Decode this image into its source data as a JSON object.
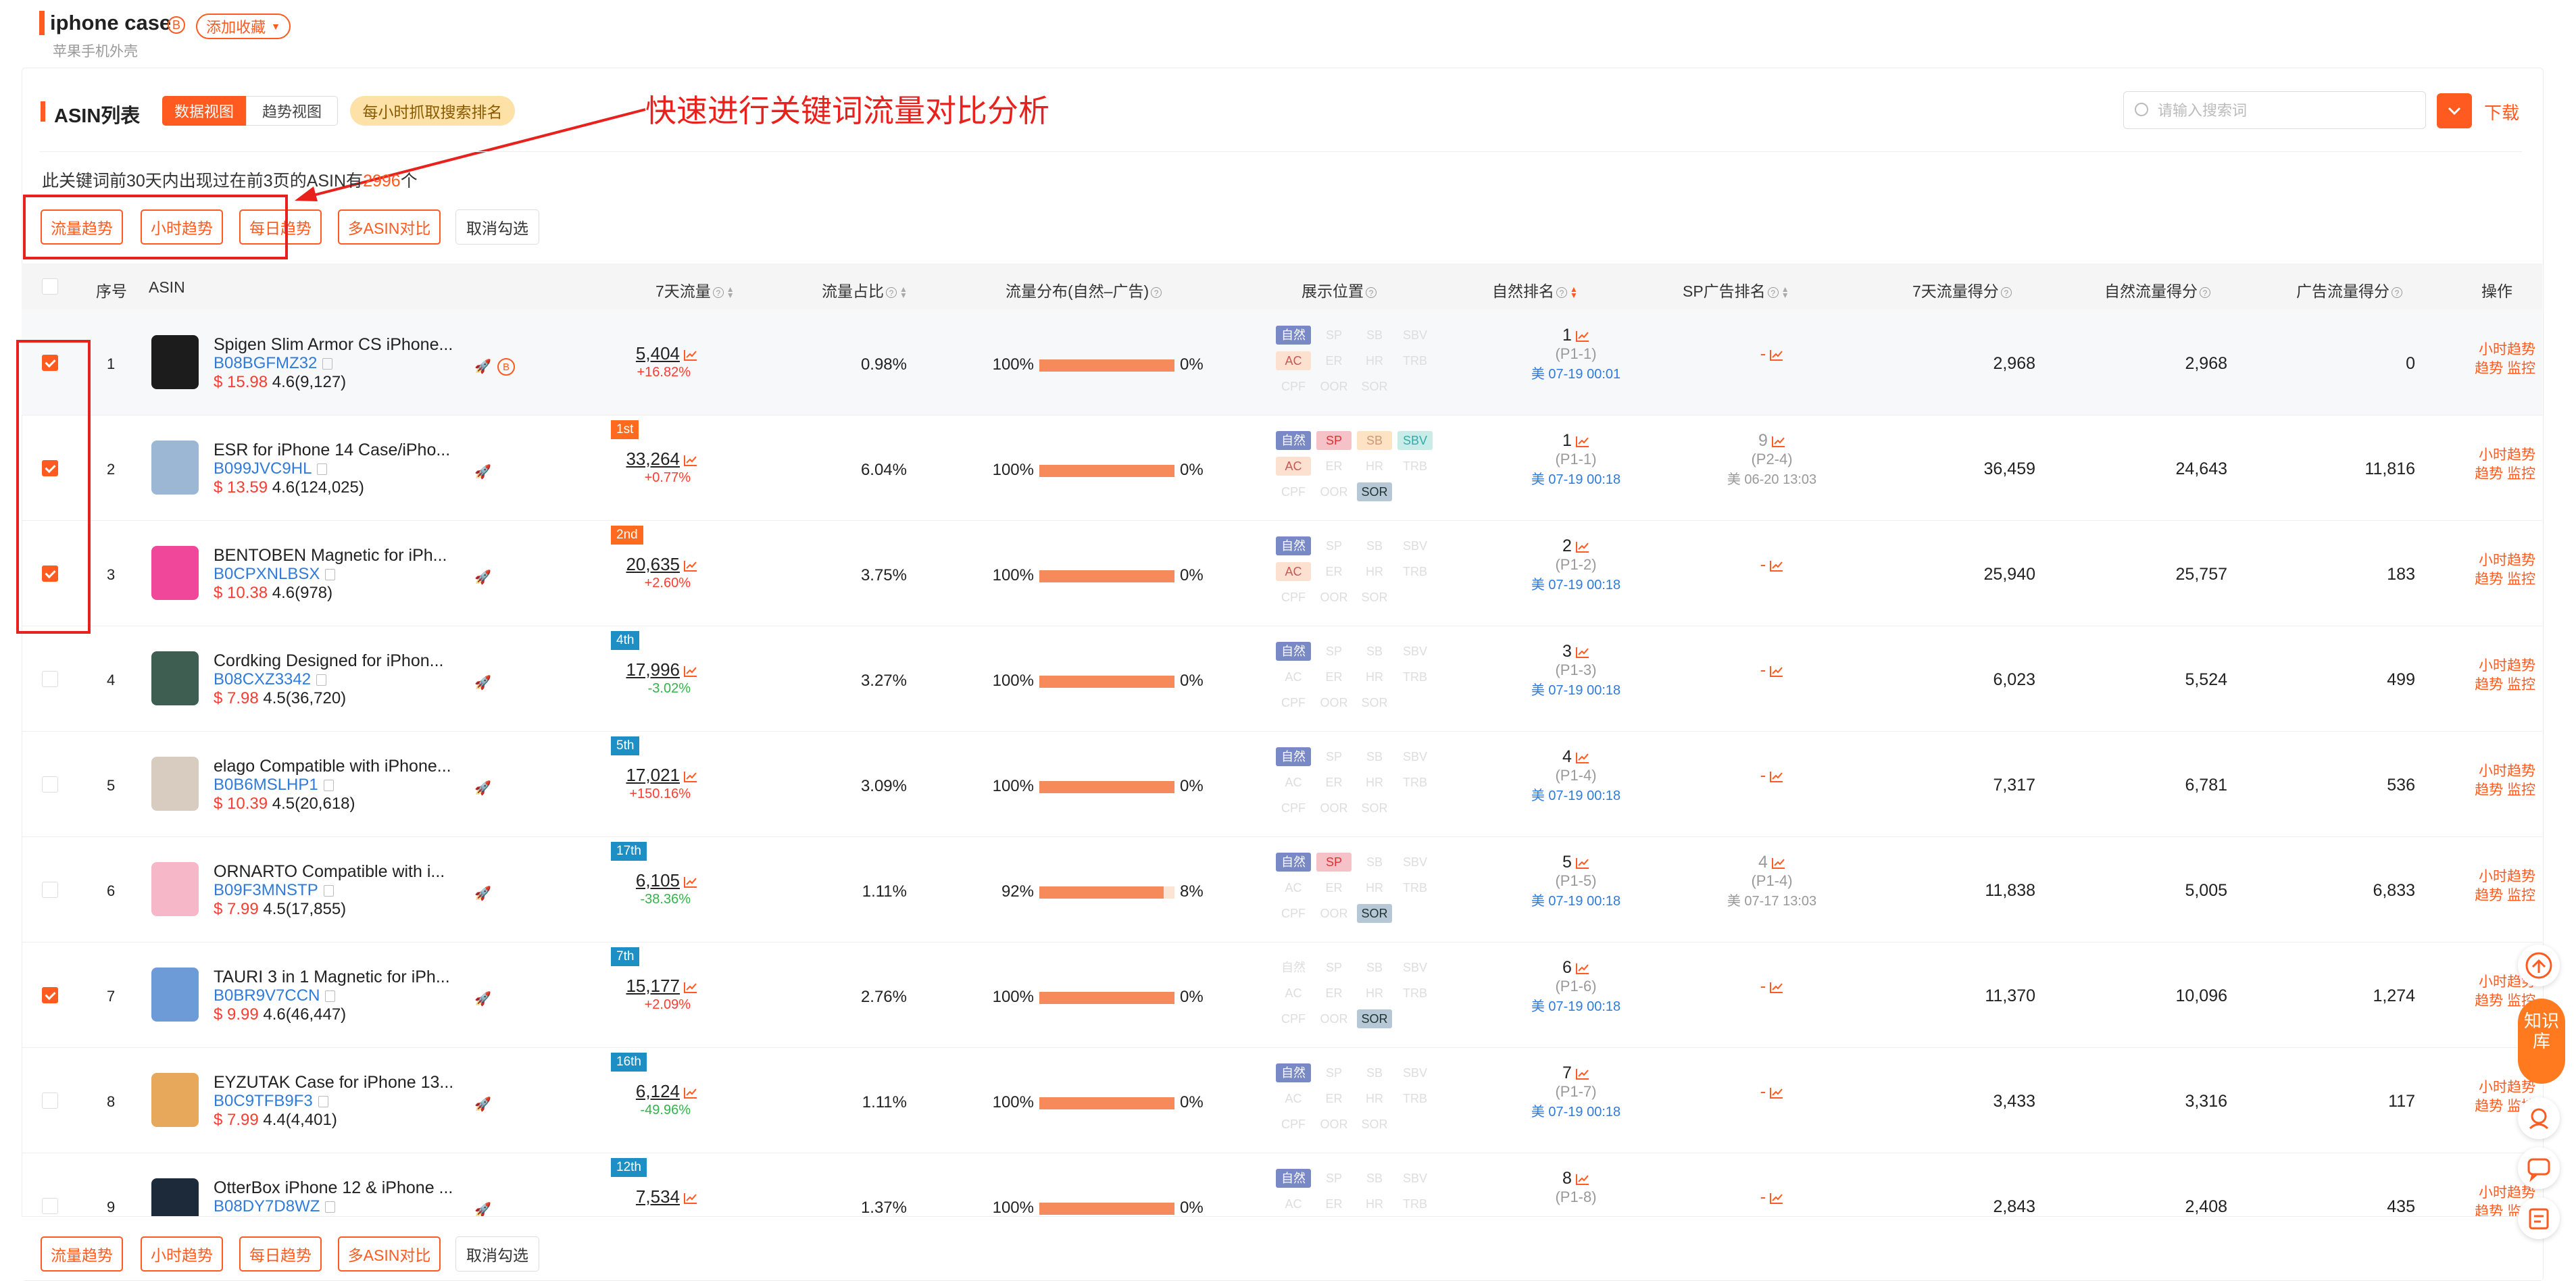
{
  "header": {
    "keyword": "iphone case",
    "badge": "B",
    "add_favorite": "添加收藏",
    "translation": "苹果手机外壳"
  },
  "section": {
    "title": "ASIN列表",
    "tab_data": "数据视图",
    "tab_trend": "趋势视图",
    "hourly_pill": "每小时抓取搜索排名",
    "annotation": "快速进行关键词流量对比分析",
    "search_placeholder": "请输入搜索词",
    "download": "下载",
    "summary_prefix": "此关键词前30天内出现过在前3页的ASIN有",
    "summary_count": "2996",
    "summary_suffix": "个"
  },
  "actions": {
    "flow_trend": "流量趋势",
    "hourly_trend": "小时趋势",
    "daily_trend": "每日趋势",
    "multi_asin": "多ASIN对比",
    "cancel": "取消勾选"
  },
  "columns": {
    "index": "序号",
    "asin": "ASIN",
    "flow7": "7天流量",
    "share": "流量占比",
    "dist": "流量分布(自然–广告)",
    "pos": "展示位置",
    "natural_rank": "自然排名",
    "sp_rank": "SP广告排名",
    "score7": "7天流量得分",
    "natural_score": "自然流量得分",
    "ad_score": "广告流量得分",
    "ops": "操作"
  },
  "tags": {
    "nat": "自然",
    "sp": "SP",
    "sb": "SB",
    "sbv": "SBV",
    "ac": "AC",
    "er": "ER",
    "hr": "HR",
    "trb": "TRB",
    "cpf": "CPF",
    "oor": "OOR",
    "sor": "SOR"
  },
  "row_ops": {
    "hourly": "小时趋势",
    "trend": "趋势",
    "monitor": "监控"
  },
  "colors": {
    "accent": "#ff5a1f",
    "link": "#2f7bdc",
    "annotation": "#e8211d"
  },
  "rows": [
    {
      "idx": "1",
      "checked": true,
      "title": "Spigen Slim Armor CS iPhone...",
      "asin": "B08BGFMZ32",
      "price": "$ 15.98",
      "rating": "4.6(9,127)",
      "rank_badge": "",
      "badge_color": "",
      "flow": "5,404",
      "change": "+16.82%",
      "up": true,
      "share": "0.98%",
      "nat_pct": "100%",
      "ad_pct": "0%",
      "nat_frac": 1.0,
      "show_b": true,
      "active": [
        "nat",
        "ac"
      ],
      "nr_num": "1",
      "nr_page": "(P1-1)",
      "nr_time": "美 07-19 00:01",
      "sp_num": "",
      "sp_page": "",
      "sp_time": "",
      "score7": "2,968",
      "nat_score": "2,968",
      "ad_score": "0",
      "thumb": "#1c1c1c"
    },
    {
      "idx": "2",
      "checked": true,
      "title": "ESR for iPhone 14 Case/iPho...",
      "asin": "B099JVC9HL",
      "price": "$ 13.59",
      "rating": "4.6(124,025)",
      "rank_badge": "1st",
      "badge_color": "#ff6a1f",
      "flow": "33,264",
      "change": "+0.77%",
      "up": true,
      "share": "6.04%",
      "nat_pct": "100%",
      "ad_pct": "0%",
      "nat_frac": 1.0,
      "show_b": false,
      "active": [
        "nat",
        "sp",
        "sb",
        "sbv",
        "ac",
        "sor"
      ],
      "nr_num": "1",
      "nr_page": "(P1-1)",
      "nr_time": "美 07-19 00:18",
      "sp_num": "9",
      "sp_page": "(P2-4)",
      "sp_time": "美 06-20 13:03",
      "score7": "36,459",
      "nat_score": "24,643",
      "ad_score": "11,816",
      "thumb": "#9bb7d4"
    },
    {
      "idx": "3",
      "checked": true,
      "title": "BENTOBEN Magnetic for iPh...",
      "asin": "B0CPXNLBSX",
      "price": "$ 10.38",
      "rating": "4.6(978)",
      "rank_badge": "2nd",
      "badge_color": "#ff6a1f",
      "flow": "20,635",
      "change": "+2.60%",
      "up": true,
      "share": "3.75%",
      "nat_pct": "100%",
      "ad_pct": "0%",
      "nat_frac": 1.0,
      "show_b": false,
      "active": [
        "nat",
        "ac"
      ],
      "nr_num": "2",
      "nr_page": "(P1-2)",
      "nr_time": "美 07-19 00:18",
      "sp_num": "",
      "sp_page": "",
      "sp_time": "",
      "score7": "25,940",
      "nat_score": "25,757",
      "ad_score": "183",
      "thumb": "#f0479a"
    },
    {
      "idx": "4",
      "checked": false,
      "title": "Cordking Designed for iPhon...",
      "asin": "B08CXZ3342",
      "price": "$ 7.98",
      "rating": "4.5(36,720)",
      "rank_badge": "4th",
      "badge_color": "#1e8fc4",
      "flow": "17,996",
      "change": "-3.02%",
      "up": false,
      "share": "3.27%",
      "nat_pct": "100%",
      "ad_pct": "0%",
      "nat_frac": 1.0,
      "show_b": false,
      "active": [
        "nat"
      ],
      "nr_num": "3",
      "nr_page": "(P1-3)",
      "nr_time": "美 07-19 00:18",
      "sp_num": "",
      "sp_page": "",
      "sp_time": "",
      "score7": "6,023",
      "nat_score": "5,524",
      "ad_score": "499",
      "thumb": "#3e5e52"
    },
    {
      "idx": "5",
      "checked": false,
      "title": "elago Compatible with iPhone...",
      "asin": "B0B6MSLHP1",
      "price": "$ 10.39",
      "rating": "4.5(20,618)",
      "rank_badge": "5th",
      "badge_color": "#1e8fc4",
      "flow": "17,021",
      "change": "+150.16%",
      "up": true,
      "share": "3.09%",
      "nat_pct": "100%",
      "ad_pct": "0%",
      "nat_frac": 1.0,
      "show_b": false,
      "active": [
        "nat"
      ],
      "nr_num": "4",
      "nr_page": "(P1-4)",
      "nr_time": "美 07-19 00:18",
      "sp_num": "",
      "sp_page": "",
      "sp_time": "",
      "score7": "7,317",
      "nat_score": "6,781",
      "ad_score": "536",
      "thumb": "#d8ccc0"
    },
    {
      "idx": "6",
      "checked": false,
      "title": "ORNARTO Compatible with i...",
      "asin": "B09F3MNSTP",
      "price": "$ 7.99",
      "rating": "4.5(17,855)",
      "rank_badge": "17th",
      "badge_color": "#1e8fc4",
      "flow": "6,105",
      "change": "-38.36%",
      "up": false,
      "share": "1.11%",
      "nat_pct": "92%",
      "ad_pct": "8%",
      "nat_frac": 0.92,
      "show_b": false,
      "active": [
        "nat",
        "sp",
        "sor"
      ],
      "nr_num": "5",
      "nr_page": "(P1-5)",
      "nr_time": "美 07-19 00:18",
      "sp_num": "4",
      "sp_page": "(P1-4)",
      "sp_time": "美 07-17 13:03",
      "score7": "11,838",
      "nat_score": "5,005",
      "ad_score": "6,833",
      "thumb": "#f6b7c8"
    },
    {
      "idx": "7",
      "checked": true,
      "title": "TAURI 3 in 1 Magnetic for iPh...",
      "asin": "B0BR9V7CCN",
      "price": "$ 9.99",
      "rating": "4.6(46,447)",
      "rank_badge": "7th",
      "badge_color": "#1e8fc4",
      "flow": "15,177",
      "change": "+2.09%",
      "up": true,
      "share": "2.76%",
      "nat_pct": "100%",
      "ad_pct": "0%",
      "nat_frac": 1.0,
      "show_b": false,
      "active": [
        "sor"
      ],
      "nr_num": "6",
      "nr_page": "(P1-6)",
      "nr_time": "美 07-19 00:18",
      "sp_num": "",
      "sp_page": "",
      "sp_time": "",
      "score7": "11,370",
      "nat_score": "10,096",
      "ad_score": "1,274",
      "thumb": "#6d9bd8"
    },
    {
      "idx": "8",
      "checked": false,
      "title": "EYZUTAK Case for iPhone 13...",
      "asin": "B0C9TFB9F3",
      "price": "$ 7.99",
      "rating": "4.4(4,401)",
      "rank_badge": "16th",
      "badge_color": "#1e8fc4",
      "flow": "6,124",
      "change": "-49.96%",
      "up": false,
      "share": "1.11%",
      "nat_pct": "100%",
      "ad_pct": "0%",
      "nat_frac": 1.0,
      "show_b": false,
      "active": [
        "nat"
      ],
      "nr_num": "7",
      "nr_page": "(P1-7)",
      "nr_time": "美 07-19 00:18",
      "sp_num": "",
      "sp_page": "",
      "sp_time": "",
      "score7": "3,433",
      "nat_score": "3,316",
      "ad_score": "117",
      "thumb": "#e7a85c"
    },
    {
      "idx": "9",
      "checked": false,
      "title": "OtterBox iPhone 12 & iPhone ...",
      "asin": "B08DY7D8WZ",
      "price": "",
      "rating": "",
      "rank_badge": "12th",
      "badge_color": "#1e8fc4",
      "flow": "7,534",
      "change": "",
      "up": true,
      "share": "1.37%",
      "nat_pct": "100%",
      "ad_pct": "0%",
      "nat_frac": 1.0,
      "show_b": false,
      "active": [
        "nat"
      ],
      "nr_num": "8",
      "nr_page": "(P1-8)",
      "nr_time": "",
      "sp_num": "",
      "sp_page": "",
      "sp_time": "",
      "score7": "2,843",
      "nat_score": "2,408",
      "ad_score": "435",
      "thumb": "#1d2a3a"
    }
  ],
  "floating": {
    "kb": "知识库"
  }
}
